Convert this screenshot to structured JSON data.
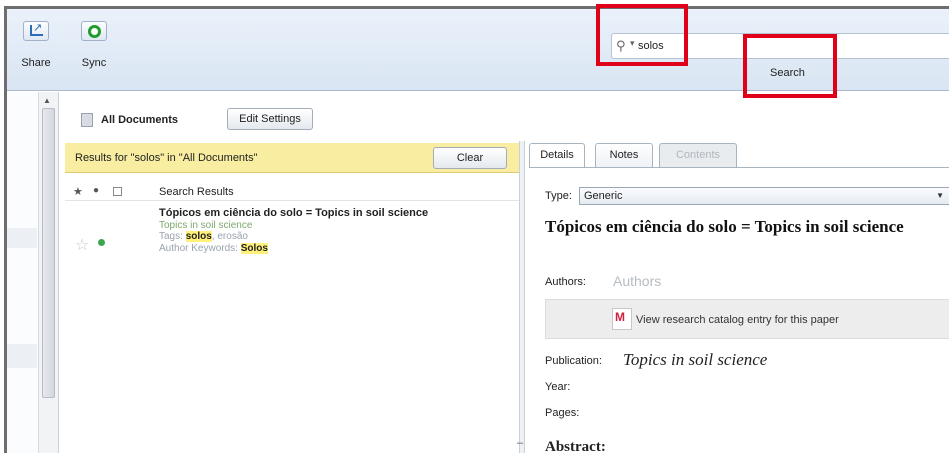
{
  "toolbar": {
    "share_label": "Share",
    "sync_label": "Sync",
    "search_value": "solos",
    "search_button_label": "Search"
  },
  "header": {
    "collection_title": "All Documents",
    "edit_settings_label": "Edit Settings"
  },
  "banner": {
    "text": "Results for \"solos\" in \"All Documents\"",
    "clear_label": "Clear"
  },
  "results": {
    "column_title": "Search Results",
    "items": [
      {
        "title": "Tópicos em ciência do solo = Topics in soil science",
        "subtitle": "Topics in soil science",
        "tags_prefix": "Tags:",
        "tag_match": "solos",
        "tags_rest": ", erosão",
        "keywords_prefix": "Author Keywords:",
        "keyword_match": "Solos",
        "starred": false,
        "read_status": "read"
      }
    ]
  },
  "details": {
    "tabs": [
      "Details",
      "Notes",
      "Contents"
    ],
    "active_tab": "Details",
    "type_label": "Type:",
    "type_value": "Generic",
    "title": "Tópicos em ciência do solo = Topics in soil science",
    "authors_label": "Authors:",
    "authors_placeholder": "Authors",
    "catalog_link": "View research catalog entry for this paper",
    "publication_label": "Publication:",
    "publication_value": "Topics in soil science",
    "year_label": "Year:",
    "pages_label": "Pages:",
    "abstract_label": "Abstract:"
  },
  "colors": {
    "highlight_box": "#e0001a",
    "banner_bg": "#f8eda1",
    "match_highlight": "#fff17a",
    "read_dot": "#3aa650"
  }
}
